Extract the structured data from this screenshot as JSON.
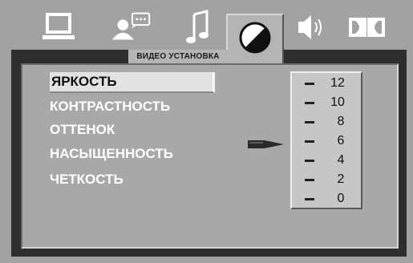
{
  "tabs": [
    {
      "id": "general",
      "icon": "monitor-icon"
    },
    {
      "id": "audio-language",
      "icon": "person-speech-icon"
    },
    {
      "id": "music",
      "icon": "music-note-icon"
    },
    {
      "id": "video",
      "icon": "contrast-circle-icon",
      "active": true,
      "caption": "ВИДЕО УСТАНОВКА"
    },
    {
      "id": "speaker",
      "icon": "speaker-icon"
    },
    {
      "id": "dolby",
      "icon": "dolby-icon"
    }
  ],
  "menu": {
    "items": [
      {
        "label": "ЯРКОСТЬ",
        "selected": true
      },
      {
        "label": "КОНТРАСТНОСТЬ"
      },
      {
        "label": "ОТТЕНОК"
      },
      {
        "label": "НАСЫЩЕННОСТЬ"
      },
      {
        "label": "ЧЕТКОСТЬ"
      }
    ]
  },
  "scale": {
    "labels": [
      "12",
      "10",
      "8",
      "6",
      "4",
      "2",
      "0"
    ],
    "current_value": "6"
  },
  "colors": {
    "background": "#a2a2a2",
    "panel": "#a8a8a8",
    "frame": "#2e2e2e",
    "menu_text": "#ffffff",
    "selected_bg": "#e2e2e2"
  }
}
